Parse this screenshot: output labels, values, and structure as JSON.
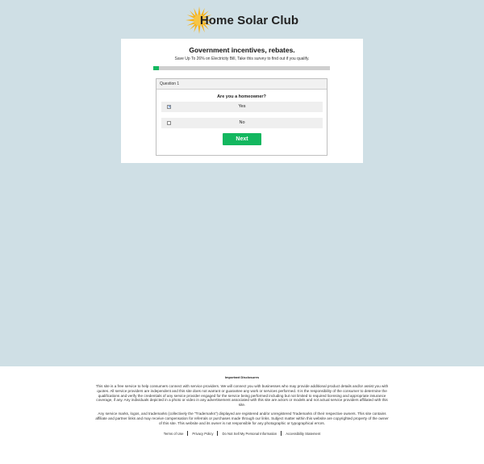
{
  "header": {
    "logo_text": "Home Solar Club",
    "logo_icon": "sun-icon"
  },
  "card": {
    "title": "Government incentives, rebates.",
    "subtitle": "Save Up To 26% on Electricity Bill, Take this survey to find out if you qualify.",
    "progress_fraction": 0.03
  },
  "question": {
    "header": "Question 1",
    "text": "Are you a homeowner?",
    "options": [
      {
        "label": "Yes",
        "checked": true
      },
      {
        "label": "No",
        "checked": false
      }
    ],
    "next_label": "Next"
  },
  "footer": {
    "disclosures_title": "Important Disclosures",
    "paragraph1": "This site is a free service to help consumers connect with service providers. We will connect you with businesses who may provide additional product details and/or assist you with quotes. All service providers are independent and this site does not warrant or guarantee any work or services performed. It is the responsibility of the consumer to determine the qualifications and verify the credentials of any service provider engaged for the service being performed including but not limited to required licensing and appropriate insurance coverage, if any. Any individuals depicted in a photo or video in any advertisement associated with this site are actors or models and not actual service providers affiliated with this site.",
    "paragraph2": "Any service marks, logos, and trademarks (collectively the \"Trademarks\") displayed are registered and/or unregistered Trademarks of their respective owners. This site contains affiliate and partner links and may receive compensation for referrals or purchases made through our links. Subject matter within this website are copyrighted property of the owner of this site. This website and its owner is not responsible for any photographic or typographical errors.",
    "links": [
      "Terms of Use",
      "Privacy Policy",
      "Do Not Sell My Personal Information",
      "Accessibility Statement"
    ]
  },
  "colors": {
    "page_background": "#cfdfe5",
    "accent_green": "#13b75f",
    "sun_yellow": "#f6b21a"
  }
}
